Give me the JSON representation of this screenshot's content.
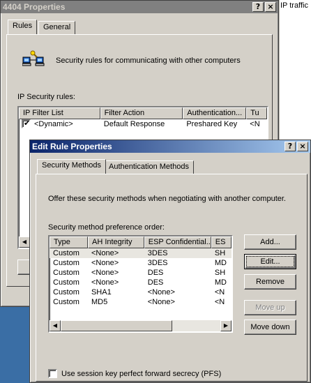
{
  "background": {
    "right_text": "IP traffic"
  },
  "props_window": {
    "title": "4404 Properties",
    "help_btn": "?",
    "close_btn": "×",
    "tabs": [
      "Rules",
      "General"
    ],
    "description": "Security rules for communicating with other computers",
    "list_label": "IP Security rules:",
    "columns": [
      "IP Filter List",
      "Filter Action",
      "Authentication...",
      "Tu"
    ],
    "rows": [
      {
        "checked": true,
        "filter": "<Dynamic>",
        "action": "Default Response",
        "auth": "Preshared Key",
        "tunnel": "<N"
      }
    ]
  },
  "edit_window": {
    "title": "Edit Rule Properties",
    "help_btn": "?",
    "close_btn": "×",
    "tabs": [
      "Security Methods",
      "Authentication Methods"
    ],
    "intro": "Offer these security methods when negotiating with another computer.",
    "list_label": "Security method preference order:",
    "columns": [
      "Type",
      "AH Integrity",
      "ESP Confidential...",
      "ES"
    ],
    "rows": [
      {
        "type": "Custom",
        "ah": "<None>",
        "esp": "3DES",
        "es": "SH"
      },
      {
        "type": "Custom",
        "ah": "<None>",
        "esp": "3DES",
        "es": "MD"
      },
      {
        "type": "Custom",
        "ah": "<None>",
        "esp": "DES",
        "es": "SH"
      },
      {
        "type": "Custom",
        "ah": "<None>",
        "esp": "DES",
        "es": "MD"
      },
      {
        "type": "Custom",
        "ah": "SHA1",
        "esp": "<None>",
        "es": "<N"
      },
      {
        "type": "Custom",
        "ah": "MD5",
        "esp": "<None>",
        "es": "<N"
      }
    ],
    "buttons": {
      "add": "Add...",
      "edit": "Edit...",
      "remove": "Remove",
      "move_up": "Move up",
      "move_down": "Move down"
    },
    "pfs_label": "Use session key perfect forward secrecy (PFS)",
    "pfs_checked": false
  }
}
